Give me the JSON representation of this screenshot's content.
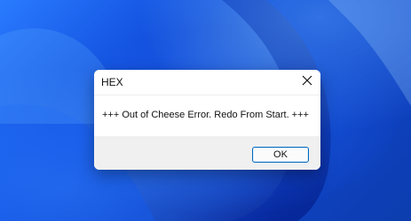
{
  "dialog": {
    "title": "HEX",
    "message": "+++ Out of Cheese Error. Redo From Start. +++",
    "ok_label": "OK"
  },
  "icons": {
    "close": "close-icon"
  },
  "colors": {
    "accent": "#0067c0",
    "dialog_bg": "#f3f3f3",
    "wallpaper": "#0e49d8"
  }
}
